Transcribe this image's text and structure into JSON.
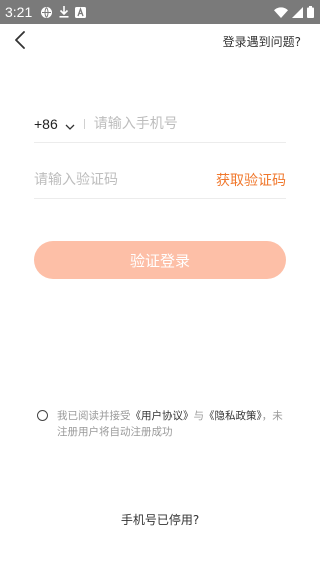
{
  "status_bar": {
    "time": "3:21",
    "left_icons": [
      "vpn-globe-icon",
      "download-icon",
      "app-a-icon"
    ],
    "right_icons": [
      "wifi-icon",
      "signal-icon",
      "battery-icon"
    ]
  },
  "header": {
    "back_icon": "chevron-left-icon",
    "help_link": "登录遇到问题?"
  },
  "form": {
    "country_code": "+86",
    "phone_placeholder": "请输入手机号",
    "code_placeholder": "请输入验证码",
    "get_code_label": "获取验证码",
    "submit_label": "验证登录"
  },
  "agreement": {
    "prefix": "我已阅读并接受",
    "user_agreement": "《用户协议》",
    "and": "与",
    "privacy_policy": "《隐私政策》",
    "suffix": "，未注册用户将自动注册成功"
  },
  "footer": {
    "disabled_phone_link": "手机号已停用?"
  },
  "colors": {
    "accent": "#f0782d",
    "button_disabled": "#fdbfa7",
    "status_bar": "#7a7a7a"
  }
}
